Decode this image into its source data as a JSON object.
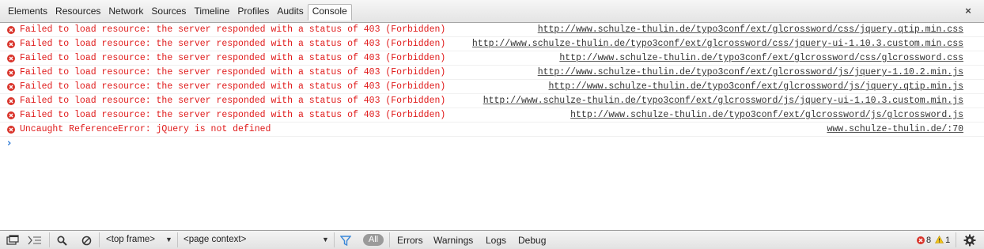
{
  "tabs": [
    {
      "label": "Elements"
    },
    {
      "label": "Resources"
    },
    {
      "label": "Network"
    },
    {
      "label": "Sources"
    },
    {
      "label": "Timeline"
    },
    {
      "label": "Profiles"
    },
    {
      "label": "Audits"
    },
    {
      "label": "Console",
      "active": true
    }
  ],
  "close_label": "×",
  "messages": [
    {
      "text": "Failed to load resource: the server responded with a status of 403 (Forbidden)",
      "source": "http://www.schulze-thulin.de/typo3conf/ext/glcrossword/css/jquery.qtip.min.css"
    },
    {
      "text": "Failed to load resource: the server responded with a status of 403 (Forbidden)",
      "source": "http://www.schulze-thulin.de/typo3conf/ext/glcrossword/css/jquery-ui-1.10.3.custom.min.css"
    },
    {
      "text": "Failed to load resource: the server responded with a status of 403 (Forbidden)",
      "source": "http://www.schulze-thulin.de/typo3conf/ext/glcrossword/css/glcrossword.css"
    },
    {
      "text": "Failed to load resource: the server responded with a status of 403 (Forbidden)",
      "source": "http://www.schulze-thulin.de/typo3conf/ext/glcrossword/js/jquery-1.10.2.min.js"
    },
    {
      "text": "Failed to load resource: the server responded with a status of 403 (Forbidden)",
      "source": "http://www.schulze-thulin.de/typo3conf/ext/glcrossword/js/jquery.qtip.min.js"
    },
    {
      "text": "Failed to load resource: the server responded with a status of 403 (Forbidden)",
      "source": "http://www.schulze-thulin.de/typo3conf/ext/glcrossword/js/jquery-ui-1.10.3.custom.min.js"
    },
    {
      "text": "Failed to load resource: the server responded with a status of 403 (Forbidden)",
      "source": "http://www.schulze-thulin.de/typo3conf/ext/glcrossword/js/glcrossword.js"
    },
    {
      "text": "Uncaught ReferenceError: jQuery is not defined",
      "source": "www.schulze-thulin.de/:70"
    }
  ],
  "prompt_caret": "›",
  "statusbar": {
    "frame_select": "<top frame>",
    "context_select": "<page context>",
    "all_label": "All",
    "filters": [
      "Errors",
      "Warnings",
      "Logs",
      "Debug"
    ],
    "error_count": "8",
    "warning_count": "1"
  },
  "icons": {
    "dock": "dock-icon",
    "show-drawer": "show-drawer-icon",
    "search": "search-icon",
    "clear": "clear-console-icon",
    "filter": "filter-icon",
    "settings": "gear-icon"
  },
  "colors": {
    "error_text": "#e01b1b",
    "error_icon": "#d9342b",
    "prompt_caret": "#2f7bd6",
    "filter_icon": "#3a87d8",
    "warning_icon": "#f2c31a"
  }
}
